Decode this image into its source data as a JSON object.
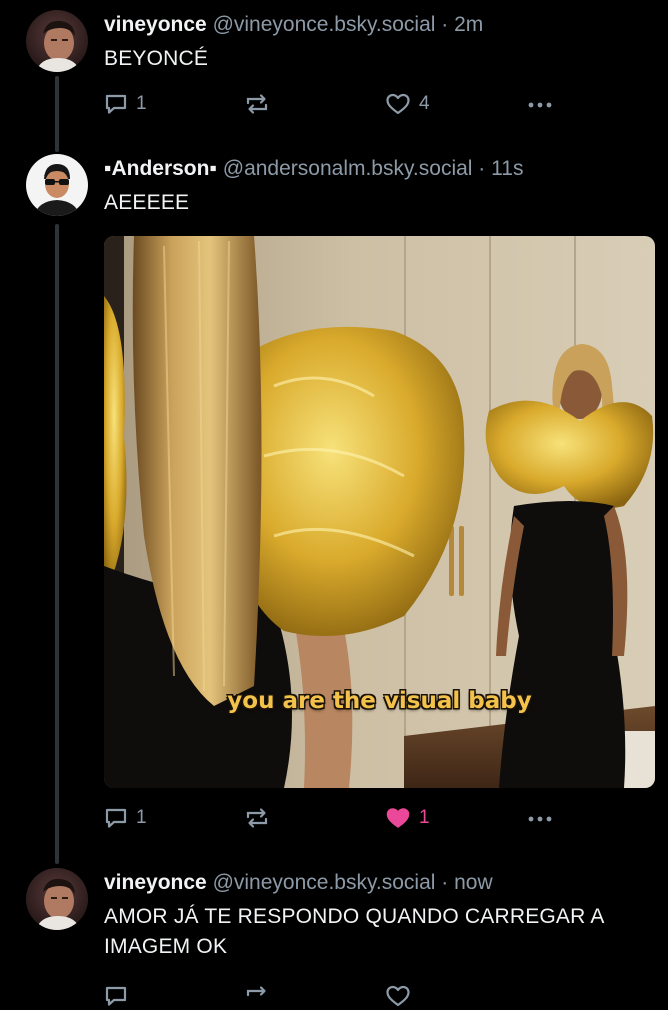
{
  "posts": [
    {
      "display_name": "vineyonce",
      "handle": "@vineyonce.bsky.social",
      "separator": "·",
      "time": "2m",
      "text": "BEYONCÉ",
      "reply_count": "1",
      "repost_count": "",
      "like_count": "4"
    },
    {
      "display_name": "▪Anderson▪",
      "handle": "@andersonalm.bsky.social",
      "separator": "·",
      "time": "11s",
      "text": "AEEEEE",
      "image_caption": "you are the visual baby",
      "reply_count": "1",
      "repost_count": "",
      "like_count": "1",
      "liked": true
    },
    {
      "display_name": "vineyonce",
      "handle": "@vineyonce.bsky.social",
      "separator": "·",
      "time": "now",
      "text": "AMOR JÁ TE RESPONDO QUANDO CARREGAR A IMAGEM OK"
    }
  ],
  "icons": {
    "reply": "reply-bubble-icon",
    "repost": "repost-arrows-icon",
    "like": "heart-icon",
    "more": "more-dots-icon"
  },
  "colors": {
    "background": "#000000",
    "text": "#f1f3f5",
    "muted": "#8d9aa7",
    "thread_line": "#2e3338",
    "like_active": "#ec4899",
    "caption": "#f3c24a"
  }
}
